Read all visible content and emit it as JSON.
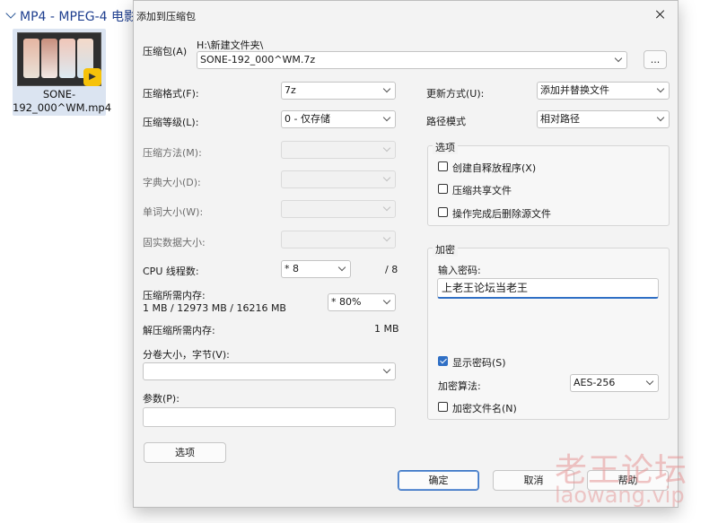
{
  "explorer": {
    "header_title": "MP4 - MPEG-4 电影",
    "file": {
      "name": "SONE-192_000^WM.mp4",
      "badge": "▶"
    }
  },
  "dialog": {
    "title": "添加到压缩包",
    "archive": {
      "label": "压缩包(A)",
      "path": "H:\\新建文件夹\\",
      "filename": "SONE-192_000^WM.7z",
      "browse_label": "..."
    },
    "left": {
      "format": {
        "label": "压缩格式(F):",
        "value": "7z"
      },
      "level": {
        "label": "压缩等级(L):",
        "value": "0 - 仅存储"
      },
      "method": {
        "label": "压缩方法(M):",
        "value": ""
      },
      "dict_size": {
        "label": "字典大小(D):",
        "value": ""
      },
      "word_size": {
        "label": "单词大小(W):",
        "value": ""
      },
      "solid_size": {
        "label": "固实数据大小:",
        "value": ""
      },
      "threads": {
        "label": "CPU 线程数:",
        "value": "* 8",
        "max": "/ 8"
      },
      "memory": {
        "label": "压缩所需内存:",
        "detail": "1 MB / 12973 MB / 16216 MB",
        "percent": "* 80%"
      },
      "decompress_memory": {
        "label": "解压缩所需内存:",
        "value": "1 MB"
      },
      "volume": {
        "label": "分卷大小，字节(V):",
        "value": ""
      },
      "params": {
        "label": "参数(P):",
        "value": ""
      },
      "options_button": "选项"
    },
    "right": {
      "update_mode": {
        "label": "更新方式(U):",
        "value": "添加并替换文件"
      },
      "path_mode": {
        "label": "路径模式",
        "value": "相对路径"
      },
      "options_group": {
        "title": "选项",
        "sfx": {
          "label": "创建自释放程序(X)",
          "checked": false
        },
        "shared": {
          "label": "压缩共享文件",
          "checked": false
        },
        "delete_after": {
          "label": "操作完成后删除源文件",
          "checked": false
        }
      },
      "encryption_group": {
        "title": "加密",
        "password_label": "输入密码:",
        "password_value": "上老王论坛当老王",
        "show_password": {
          "label": "显示密码(S)",
          "checked": true
        },
        "method_label": "加密算法:",
        "method_value": "AES-256",
        "encrypt_names": {
          "label": "加密文件名(N)",
          "checked": false
        }
      }
    },
    "buttons": {
      "ok": "确定",
      "cancel": "取消",
      "help": "帮助"
    }
  },
  "watermark": {
    "text": "老王论坛",
    "url": "laowang.vip"
  },
  "colors": {
    "accent": "#2f6fc5",
    "dialog_bg": "#f3f3f3",
    "explorer_title": "#1f3f8f"
  }
}
